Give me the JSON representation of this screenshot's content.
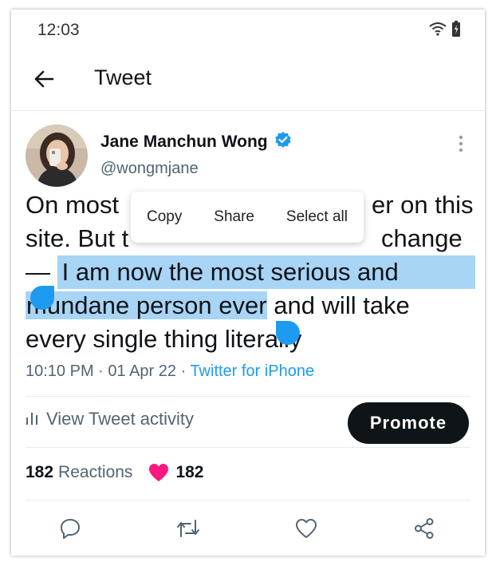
{
  "status_bar": {
    "time": "12:03"
  },
  "header": {
    "title": "Tweet"
  },
  "author": {
    "name": "Jane Manchun Wong",
    "handle": "@wongmjane"
  },
  "tweet": {
    "line1_start": "On most",
    "line1_end": "er on this",
    "line2_start": "site. But t",
    "line2_end": "change",
    "line3_prefix": "— ",
    "line3_selected": "I am now the most serious and",
    "line4_selected": "mundane person ever",
    "line4_rest": " and will take",
    "line5": "every single thing literally"
  },
  "context_menu": {
    "copy": "Copy",
    "share": "Share",
    "select_all": "Select all"
  },
  "meta": {
    "time": "10:10 PM",
    "sep1": " · ",
    "date": "01 Apr 22",
    "sep2": " · ",
    "source": "Twitter for iPhone"
  },
  "activity": {
    "label": "View Tweet activity",
    "promote": "Promote"
  },
  "reactions": {
    "count": "182",
    "label": "Reactions",
    "likes": "182"
  },
  "colors": {
    "accent": "#1d9bf0",
    "selection": "#a8d4f5",
    "heart": "#f91880",
    "dark": "#0f1419"
  },
  "icons": [
    "back-arrow-icon",
    "wifi-icon",
    "battery-icon",
    "verified-badge-icon",
    "more-vertical-icon",
    "bar-chart-icon",
    "heart-icon",
    "reply-icon",
    "retweet-icon",
    "like-icon",
    "share-icon"
  ]
}
